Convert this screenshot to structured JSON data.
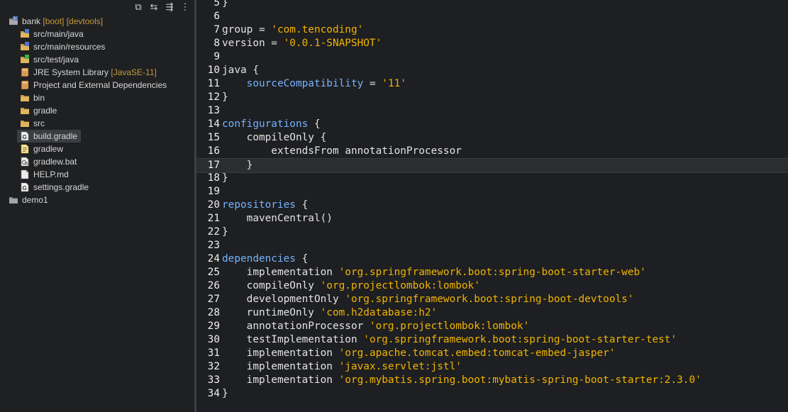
{
  "explorer": {
    "toolbar": [
      {
        "name": "collapse-all-icon",
        "glyph": "⧉"
      },
      {
        "name": "link-editor-icon",
        "glyph": "⇆"
      },
      {
        "name": "filter-icon",
        "glyph": "⇶"
      },
      {
        "name": "more-menu-icon",
        "glyph": "⋮"
      }
    ],
    "tree": [
      {
        "label": "bank",
        "decoration": " [boot] [devtools]",
        "icon": "project-icon",
        "expand": "v"
      },
      {
        "label": "src/main/java",
        "decoration": "",
        "icon": "source-folder-icon",
        "expand": ">"
      },
      {
        "label": "src/main/resources",
        "decoration": "",
        "icon": "source-folder-icon",
        "expand": ">"
      },
      {
        "label": "src/test/java",
        "decoration": "",
        "icon": "test-folder-icon",
        "expand": ">"
      },
      {
        "label": "JRE System Library",
        "decoration": " [JavaSE-11]",
        "icon": "library-icon",
        "expand": ">"
      },
      {
        "label": "Project and External Dependencies",
        "decoration": "",
        "icon": "library-icon",
        "expand": ">"
      },
      {
        "label": "bin",
        "decoration": "",
        "icon": "folder-icon",
        "expand": ">"
      },
      {
        "label": "gradle",
        "decoration": "",
        "icon": "folder-icon",
        "expand": ">"
      },
      {
        "label": "src",
        "decoration": "",
        "icon": "folder-icon",
        "expand": ">"
      },
      {
        "label": "build.gradle",
        "decoration": "",
        "icon": "gradle-file-icon",
        "expand": ""
      },
      {
        "label": "gradlew",
        "decoration": "",
        "icon": "text-file-icon",
        "expand": ""
      },
      {
        "label": "gradlew.bat",
        "decoration": "",
        "icon": "bat-file-icon",
        "expand": ""
      },
      {
        "label": "HELP.md",
        "decoration": "",
        "icon": "file-icon",
        "expand": ""
      },
      {
        "label": "settings.gradle",
        "decoration": "",
        "icon": "gradle-file-icon",
        "expand": ""
      },
      {
        "label": "demo1",
        "decoration": "",
        "icon": "closed-project-icon",
        "expand": ""
      }
    ]
  },
  "editor": {
    "lines": [
      {
        "n": "5",
        "parts": [
          [
            "p",
            "}"
          ]
        ]
      },
      {
        "n": "6",
        "parts": []
      },
      {
        "n": "7",
        "parts": [
          [
            "p",
            "group = "
          ],
          [
            "s",
            "'com.tencoding'"
          ]
        ]
      },
      {
        "n": "8",
        "parts": [
          [
            "p",
            "version = "
          ],
          [
            "s",
            "'0.0.1-SNAPSHOT'"
          ]
        ]
      },
      {
        "n": "9",
        "parts": []
      },
      {
        "n": "10",
        "parts": [
          [
            "p",
            "java {"
          ]
        ]
      },
      {
        "n": "11",
        "parts": [
          [
            "p",
            "    "
          ],
          [
            "k",
            "sourceCompatibility"
          ],
          [
            "p",
            " = "
          ],
          [
            "s",
            "'11'"
          ]
        ]
      },
      {
        "n": "12",
        "parts": [
          [
            "p",
            "}"
          ]
        ]
      },
      {
        "n": "13",
        "parts": []
      },
      {
        "n": "14",
        "parts": [
          [
            "k",
            "configurations"
          ],
          [
            "p",
            " {"
          ]
        ]
      },
      {
        "n": "15",
        "parts": [
          [
            "p",
            "    compileOnly {"
          ]
        ]
      },
      {
        "n": "16",
        "parts": [
          [
            "p",
            "        extendsFrom annotationProcessor"
          ]
        ]
      },
      {
        "n": "17",
        "parts": [
          [
            "p",
            "    }"
          ]
        ],
        "current": true
      },
      {
        "n": "18",
        "parts": [
          [
            "p",
            "}"
          ]
        ]
      },
      {
        "n": "19",
        "parts": []
      },
      {
        "n": "20",
        "parts": [
          [
            "k",
            "repositories"
          ],
          [
            "p",
            " {"
          ]
        ]
      },
      {
        "n": "21",
        "parts": [
          [
            "p",
            "    mavenCentral()"
          ]
        ]
      },
      {
        "n": "22",
        "parts": [
          [
            "p",
            "}"
          ]
        ]
      },
      {
        "n": "23",
        "parts": []
      },
      {
        "n": "24",
        "parts": [
          [
            "k",
            "dependencies"
          ],
          [
            "p",
            " {"
          ]
        ]
      },
      {
        "n": "25",
        "parts": [
          [
            "p",
            "    implementation "
          ],
          [
            "s",
            "'org.springframework.boot:spring-boot-starter-web'"
          ]
        ]
      },
      {
        "n": "26",
        "parts": [
          [
            "p",
            "    compileOnly "
          ],
          [
            "s",
            "'org.projectlombok:lombok'"
          ]
        ]
      },
      {
        "n": "27",
        "parts": [
          [
            "p",
            "    developmentOnly "
          ],
          [
            "s",
            "'org.springframework.boot:spring-boot-devtools'"
          ]
        ]
      },
      {
        "n": "28",
        "parts": [
          [
            "p",
            "    runtimeOnly "
          ],
          [
            "s",
            "'com.h2database:h2'"
          ]
        ]
      },
      {
        "n": "29",
        "parts": [
          [
            "p",
            "    annotationProcessor "
          ],
          [
            "s",
            "'org.projectlombok:lombok'"
          ]
        ]
      },
      {
        "n": "30",
        "parts": [
          [
            "p",
            "    testImplementation "
          ],
          [
            "s",
            "'org.springframework.boot:spring-boot-starter-test'"
          ]
        ]
      },
      {
        "n": "31",
        "parts": [
          [
            "p",
            "    implementation "
          ],
          [
            "s",
            "'org.apache.tomcat.embed:tomcat-embed-jasper'"
          ]
        ]
      },
      {
        "n": "32",
        "parts": [
          [
            "p",
            "    implementation "
          ],
          [
            "s",
            "'javax.servlet:jstl'"
          ]
        ]
      },
      {
        "n": "33",
        "parts": [
          [
            "p",
            "    implementation "
          ],
          [
            "s",
            "'org.mybatis.spring.boot:mybatis-spring-boot-starter:2.3.0'"
          ]
        ]
      },
      {
        "n": "34",
        "parts": [
          [
            "p",
            "}"
          ]
        ]
      }
    ]
  },
  "colors": {
    "string": "#f0b400",
    "keyword": "#74b4ff",
    "background": "#1e1f22"
  }
}
